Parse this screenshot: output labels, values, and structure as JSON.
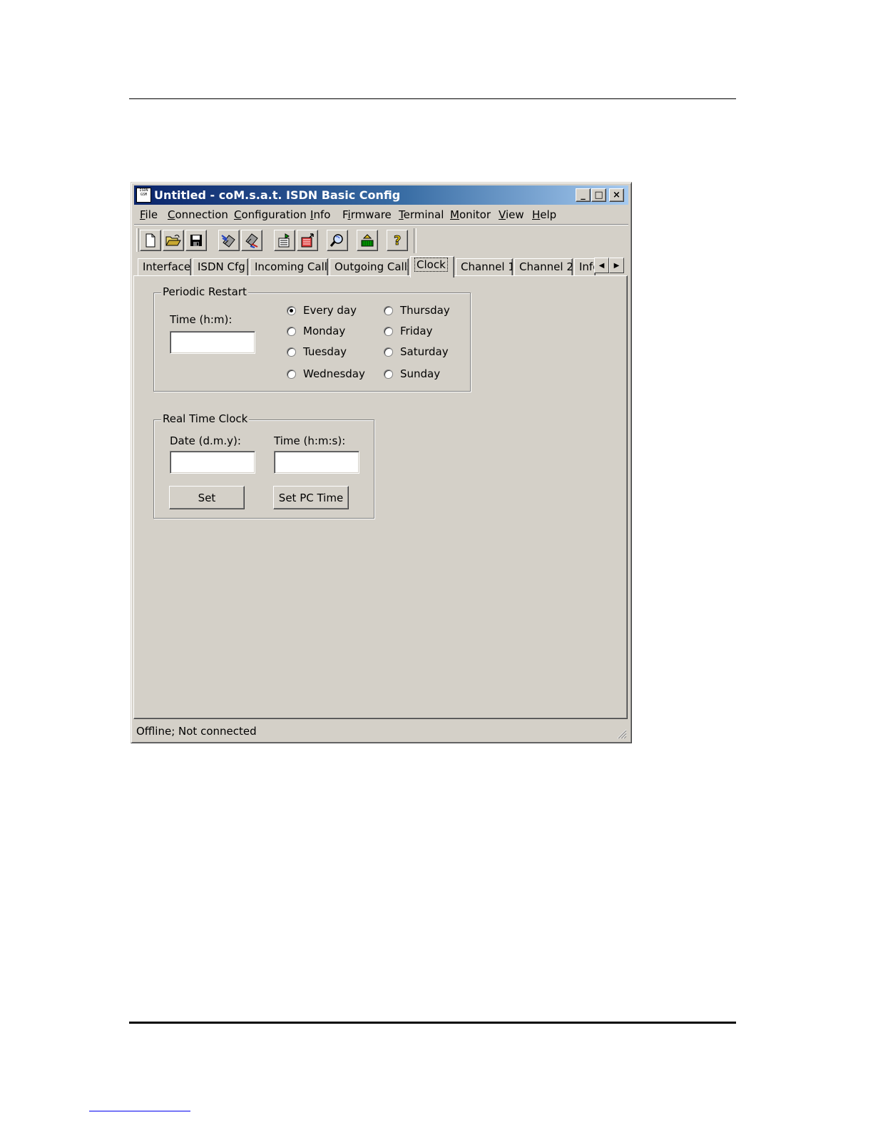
{
  "window": {
    "title": "Untitled - coM.s.a.t. ISDN Basic Config",
    "icon_text": "ISDN GSM",
    "caption_buttons": {
      "minimize": "_",
      "maximize": "□",
      "close": "×"
    }
  },
  "menu": {
    "items": [
      {
        "label": "File",
        "accel": "F",
        "rest": "ile"
      },
      {
        "label": "Connection",
        "accel": "C",
        "rest": "onnection"
      },
      {
        "label": "Configuration",
        "accel": "C",
        "rest": "onfiguration"
      },
      {
        "label": "Info",
        "accel": "I",
        "rest": "nfo"
      },
      {
        "label": "Firmware",
        "pre": "F",
        "accel": "i",
        "rest": "rmware"
      },
      {
        "label": "Terminal",
        "accel": "T",
        "rest": "erminal"
      },
      {
        "label": "Monitor",
        "accel": "M",
        "rest": "onitor"
      },
      {
        "label": "View",
        "accel": "V",
        "rest": "iew"
      },
      {
        "label": "Help",
        "accel": "H",
        "rest": "elp"
      }
    ]
  },
  "toolbar": {
    "buttons": [
      "new-icon",
      "open-icon",
      "save-icon",
      "read-device-icon",
      "write-device-icon",
      "upload-icon",
      "download-icon",
      "find-icon",
      "firmware-icon",
      "help-icon"
    ]
  },
  "tabs": {
    "items": [
      "Interface",
      "ISDN Cfg",
      "Incoming Calls",
      "Outgoing Calls",
      "Clock",
      "Channel 1",
      "Channel 2",
      "Info"
    ],
    "active": "Clock"
  },
  "periodic_restart": {
    "label": "Periodic Restart",
    "time_label": "Time (h:m):",
    "time_value": "",
    "days": [
      "Every day",
      "Monday",
      "Tuesday",
      "Wednesday",
      "Thursday",
      "Friday",
      "Saturday",
      "Sunday"
    ],
    "selected": "Every day"
  },
  "real_time_clock": {
    "label": "Real Time Clock",
    "date_label": "Date (d.m.y):",
    "date_value": "",
    "time_label": "Time (h:m:s):",
    "time_value": "",
    "set_button": "Set",
    "set_pc_time_button": "Set PC Time"
  },
  "status": {
    "text": "Offline; Not connected"
  }
}
